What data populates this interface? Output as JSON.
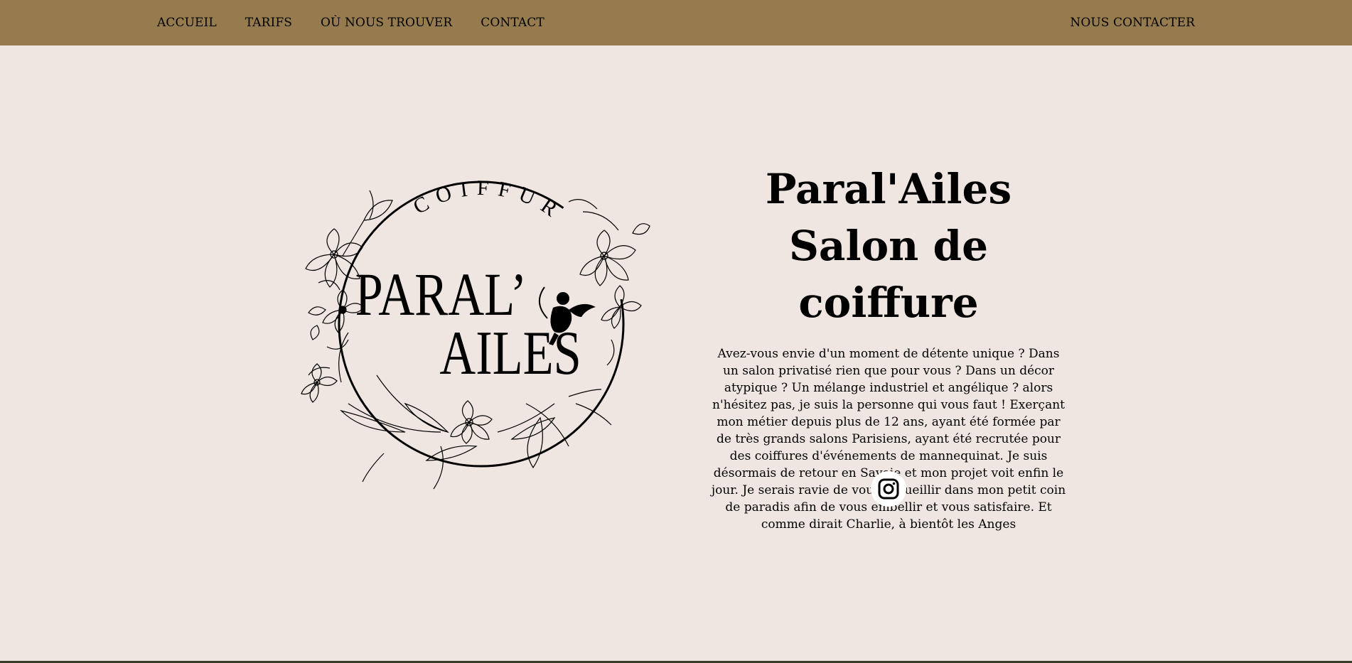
{
  "nav": {
    "left": [
      "ACCUEIL",
      "TARIFS",
      "OÙ NOUS TROUVER",
      "CONTACT"
    ],
    "right_cta": "NOUS CONTACTER"
  },
  "logo": {
    "top_text": "COIFFURE",
    "line1": "PARAL’",
    "line2": "AILES"
  },
  "hero": {
    "title_line1": "Paral'Ailes",
    "title_line2": "Salon de coiffure",
    "description": "Avez-vous envie d'un moment de détente unique ? Dans un salon privatisé rien que pour vous ? Dans un décor atypique ? Un mélange industriel et angélique ? alors n'hésitez pas, je suis la personne qui vous faut ! Exerçant mon métier depuis plus de 12 ans, ayant été formée par de très grands salons Parisiens, ayant été recrutée pour des coiffures d'événements de mannequinat. Je suis désormais de retour en Savoie et mon projet voit enfin le jour. Je serais ravie de vous accueillir dans mon petit coin de paradis afin de vous embellir et vous satisfaire. Et comme dirait Charlie, à bientôt les Anges"
  },
  "social": {
    "icon": "instagram-icon"
  },
  "colors": {
    "topbar": "#967b4f",
    "background": "#efe6e1"
  }
}
